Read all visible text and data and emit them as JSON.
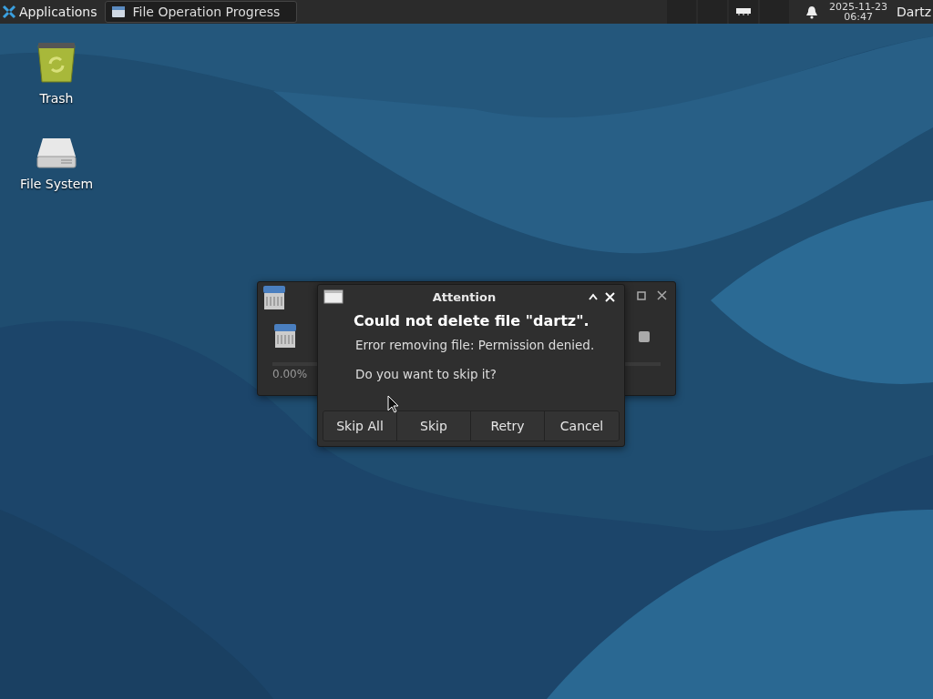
{
  "panel": {
    "menu": "Applications",
    "tasks": [
      {
        "title": "File Operation Progress",
        "selected": true
      }
    ],
    "date": "2025-11-23",
    "time": "06:47",
    "user": "Dartz"
  },
  "desktop_icons": [
    {
      "label": "Trash",
      "kind": "trash"
    },
    {
      "label": "File System",
      "kind": "drive"
    }
  ],
  "progress_window": {
    "percent": "0.00%",
    "level": 0
  },
  "dialog": {
    "title": "Attention",
    "heading": "Could not delete file \"dartz\".",
    "message": "Error removing file: Permission denied.",
    "question": "Do you want to skip it?",
    "buttons": [
      "Skip All",
      "Skip",
      "Retry",
      "Cancel"
    ]
  }
}
